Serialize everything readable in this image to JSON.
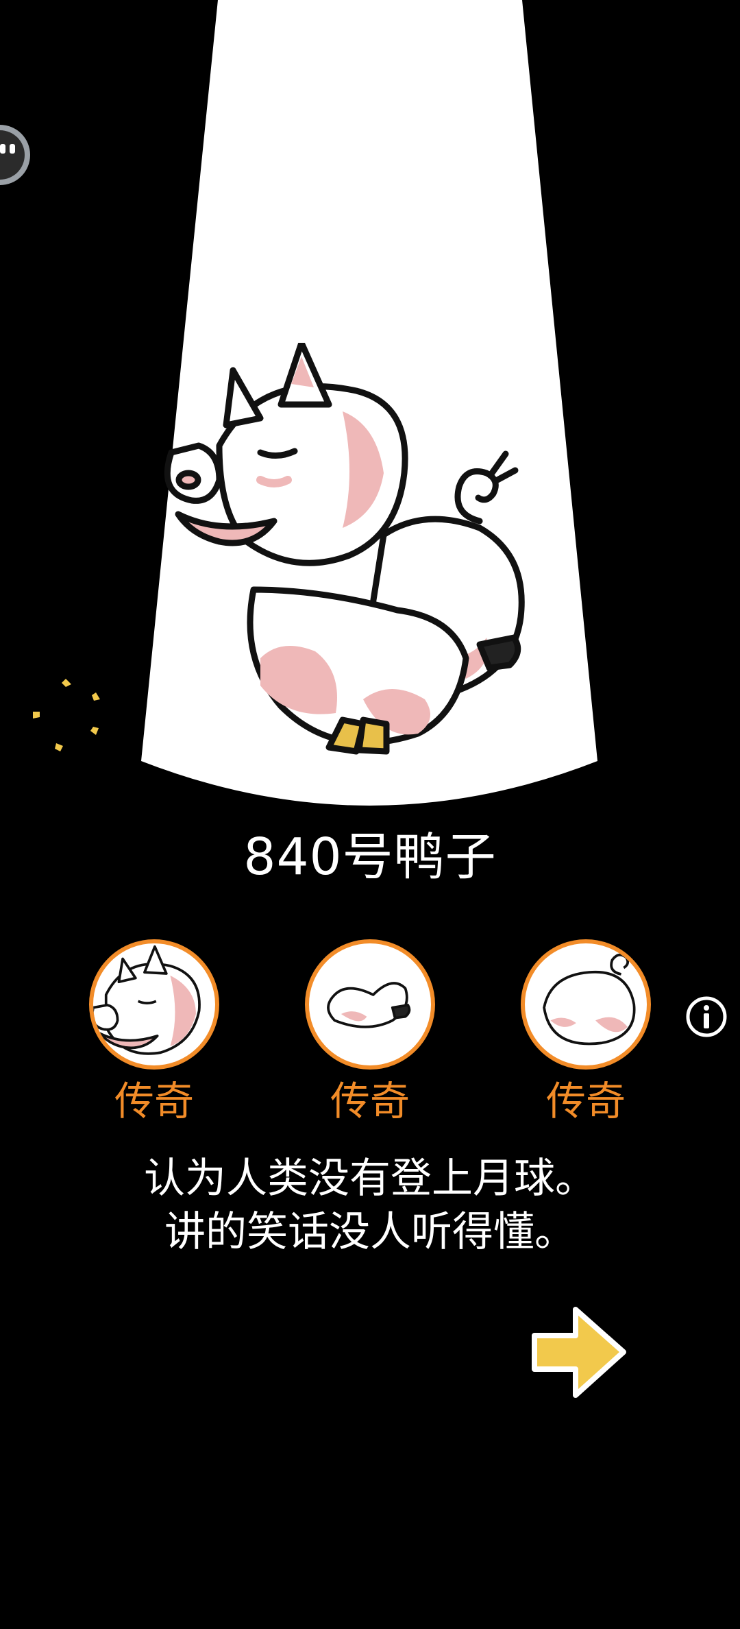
{
  "creature": {
    "name": "840号鸭子",
    "description_lines": [
      "认为人类没有登上月球。",
      "讲的笑话没人听得懂。"
    ]
  },
  "parts": [
    {
      "name": "head",
      "rarity": "传奇",
      "icon": "pig-head-icon"
    },
    {
      "name": "body",
      "rarity": "传奇",
      "icon": "pig-body-icon"
    },
    {
      "name": "rear",
      "rarity": "传奇",
      "icon": "pig-rear-icon"
    }
  ],
  "icons": {
    "info": "info-icon",
    "next": "right-arrow-icon",
    "side": "side-badge-icon",
    "sparkle": "sparkle-icon"
  },
  "colors": {
    "background": "#000000",
    "spotlight": "#FFFFFF",
    "rarity_accent": "#F28C28",
    "arrow": "#F2C94C",
    "pig_pink": "#EFB8B8"
  }
}
